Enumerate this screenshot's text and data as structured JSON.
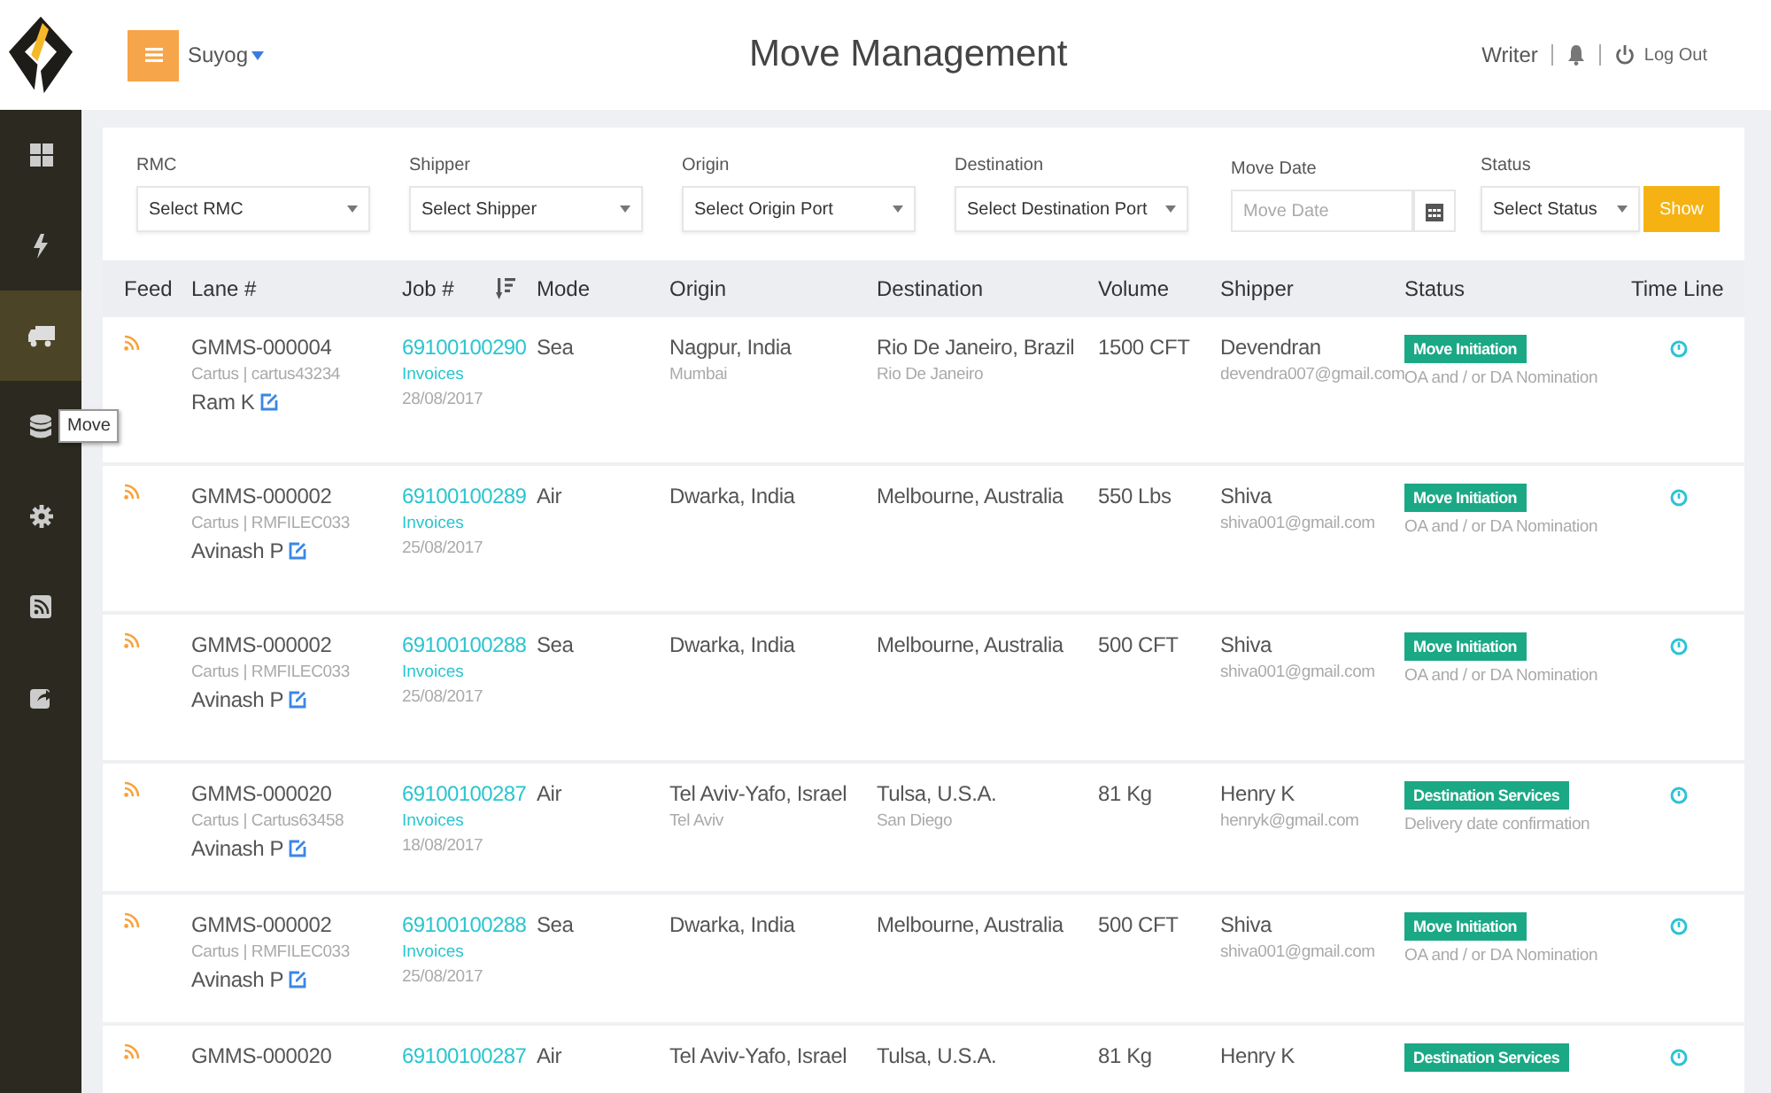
{
  "header": {
    "user": "Suyog",
    "title": "Move Management",
    "role": "Writer",
    "logout": "Log Out"
  },
  "sidebar": {
    "items": [
      {
        "kind": "dashboard",
        "selected": false
      },
      {
        "kind": "bolt",
        "selected": false
      },
      {
        "kind": "truck",
        "selected": true
      },
      {
        "kind": "database",
        "selected": false,
        "tooltip": "Move"
      },
      {
        "kind": "gear",
        "selected": false
      },
      {
        "kind": "rss",
        "selected": false
      },
      {
        "kind": "share",
        "selected": false
      }
    ]
  },
  "filters": [
    {
      "label": "RMC",
      "kind": "select",
      "placeholder": "Select RMC"
    },
    {
      "label": "Shipper",
      "kind": "select",
      "placeholder": "Select Shipper"
    },
    {
      "label": "Origin",
      "kind": "select",
      "placeholder": "Select Origin Port"
    },
    {
      "label": "Destination",
      "kind": "select",
      "placeholder": "Select Destination Port"
    },
    {
      "label": "Move Date",
      "kind": "date",
      "placeholder": "Move Date"
    },
    {
      "label": "Status",
      "kind": "select",
      "placeholder": "Select Status"
    }
  ],
  "show_button": "Show",
  "table": {
    "columns": [
      {
        "label": "Feed"
      },
      {
        "label": "Lane #"
      },
      {
        "label": "Job #",
        "sort_icon": true
      },
      {
        "label": "Mode"
      },
      {
        "label": "Origin"
      },
      {
        "label": "Destination"
      },
      {
        "label": "Volume"
      },
      {
        "label": "Shipper"
      },
      {
        "label": "Status"
      },
      {
        "label": "Time Line"
      }
    ],
    "rows": [
      {
        "lane": "GMMS-000004",
        "account": "Cartus | cartus43234",
        "coordinator": "Ram K",
        "job": "69100100290",
        "invoices": "Invoices",
        "date": "28/08/2017",
        "mode": "Sea",
        "origin": "Nagpur, India",
        "origin_city": "Mumbai",
        "destination": "Rio De Janeiro, Brazil",
        "destination_city": "Rio De Janeiro",
        "volume": "1500 CFT",
        "shipper": "Devendran",
        "email": "devendra007@gmail.com",
        "status": "Move Initiation",
        "status_note": "OA and / or DA Nomination"
      },
      {
        "lane": "GMMS-000002",
        "account": "Cartus | RMFILEC033",
        "coordinator": "Avinash P",
        "job": "69100100289",
        "invoices": "Invoices",
        "date": "25/08/2017",
        "mode": "Air",
        "origin": "Dwarka, India",
        "destination": "Melbourne, Australia",
        "volume": "550 Lbs",
        "shipper": "Shiva",
        "email": "shiva001@gmail.com",
        "status": "Move Initiation",
        "status_note": "OA and / or DA Nomination"
      },
      {
        "lane": "GMMS-000002",
        "account": "Cartus | RMFILEC033",
        "coordinator": "Avinash P",
        "job": "69100100288",
        "invoices": "Invoices",
        "date": "25/08/2017",
        "mode": "Sea",
        "origin": "Dwarka, India",
        "destination": "Melbourne, Australia",
        "volume": "500 CFT",
        "shipper": "Shiva",
        "email": "shiva001@gmail.com",
        "status": "Move Initiation",
        "status_note": "OA and / or DA Nomination"
      },
      {
        "lane": "GMMS-000020",
        "account": "Cartus | Cartus63458",
        "coordinator": "Avinash P",
        "job": "69100100287",
        "invoices": "Invoices",
        "date": "18/08/2017",
        "mode": "Air",
        "origin": "Tel Aviv-Yafo, Israel",
        "origin_city": "Tel Aviv",
        "destination": "Tulsa, U.S.A.",
        "destination_city": "San Diego",
        "volume": "81 Kg",
        "shipper": "Henry K",
        "email": "henryk@gmail.com",
        "status": "Destination Services",
        "status_note": "Delivery date confirmation"
      },
      {
        "lane": "GMMS-000002",
        "account": "Cartus | RMFILEC033",
        "coordinator": "Avinash P",
        "job": "69100100288",
        "invoices": "Invoices",
        "date": "25/08/2017",
        "mode": "Sea",
        "origin": "Dwarka, India",
        "destination": "Melbourne, Australia",
        "volume": "500 CFT",
        "shipper": "Shiva",
        "email": "shiva001@gmail.com",
        "status": "Move Initiation",
        "status_note": "OA and / or DA Nomination"
      },
      {
        "lane": "GMMS-000020",
        "job": "69100100287",
        "mode": "Air",
        "origin": "Tel Aviv-Yafo, Israel",
        "destination": "Tulsa, U.S.A.",
        "volume": "81 Kg",
        "shipper": "Henry K",
        "status": "Destination Services"
      }
    ]
  }
}
